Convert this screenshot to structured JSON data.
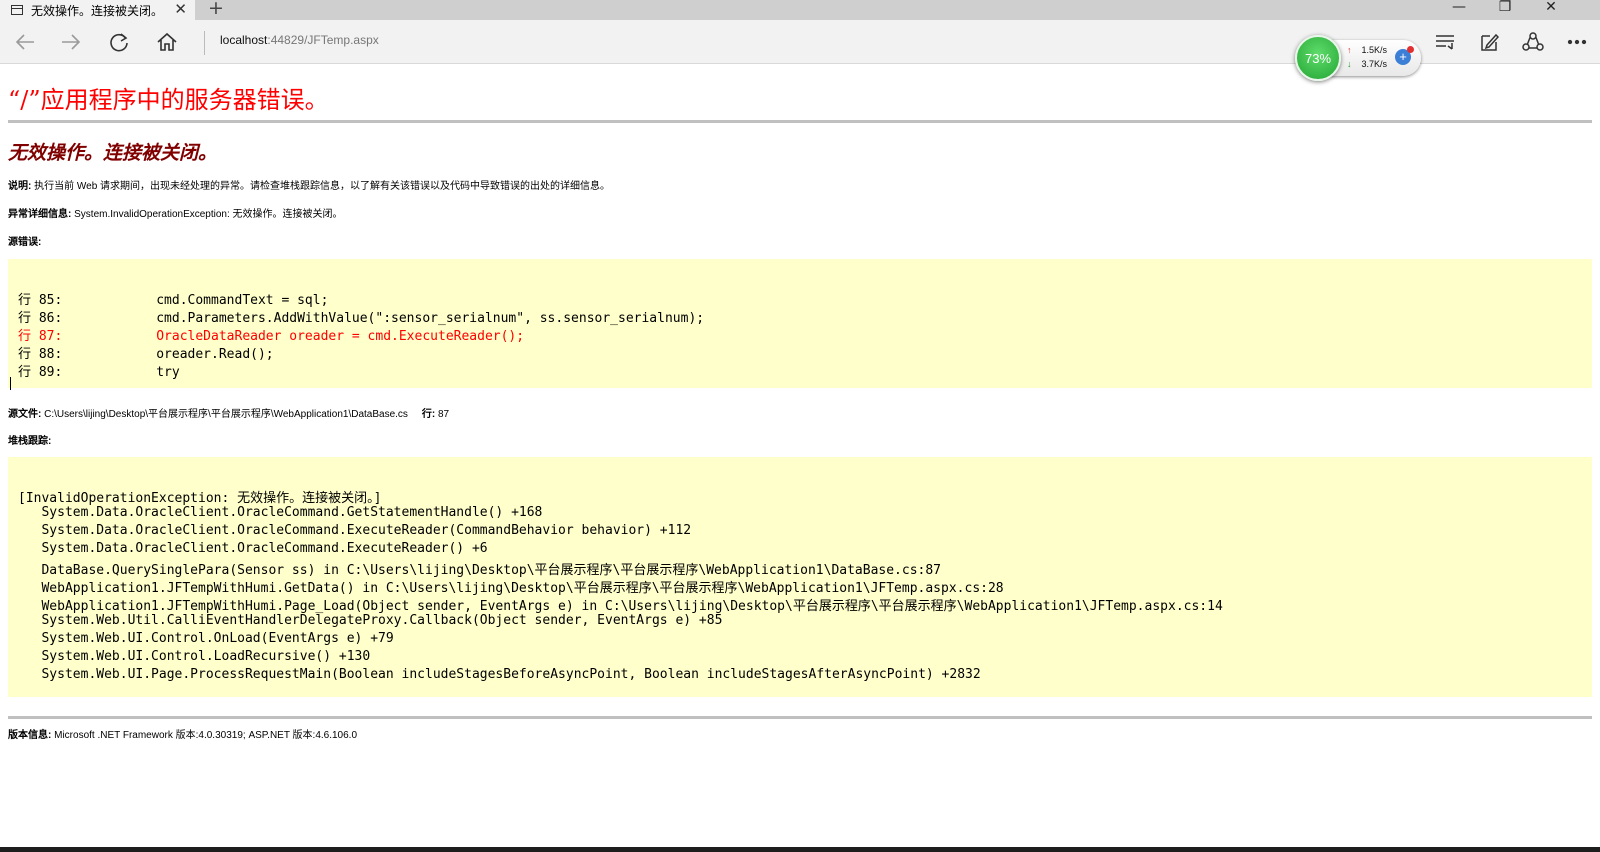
{
  "tab": {
    "title": "无效操作。连接被关闭。",
    "close": "✕",
    "new_tab": "+"
  },
  "window": {
    "minimize": "—",
    "restore": "❐",
    "close": "✕"
  },
  "address": {
    "host": "localhost",
    "path": ":44829/JFTemp.aspx"
  },
  "speed_widget": {
    "percent": "73%",
    "upload": "1.5K/s",
    "download": "3.7K/s",
    "up_arrow": "↑",
    "down_arrow": "↓",
    "plus": "+"
  },
  "error": {
    "title": "“/”应用程序中的服务器错误。",
    "subtitle": "无效操作。连接被关闭。",
    "description_label": "说明:",
    "description": " 执行当前 Web 请求期间，出现未经处理的异常。请检查堆栈跟踪信息，以了解有关该错误以及代码中导致错误的出处的详细信息。",
    "exception_label": "异常详细信息:",
    "exception": " System.InvalidOperationException: 无效操作。连接被关闭。",
    "source_error_label": "源错误:",
    "source_lines": [
      {
        "text": "行 85:            cmd.CommandText = sql;",
        "highlight": false
      },
      {
        "text": "行 86:            cmd.Parameters.AddWithValue(\":sensor_serialnum\", ss.sensor_serialnum);",
        "highlight": false
      },
      {
        "text": "行 87:            OracleDataReader oreader = cmd.ExecuteReader();",
        "highlight": true
      },
      {
        "text": "行 88:            oreader.Read();",
        "highlight": false
      },
      {
        "text": "行 89:            try",
        "highlight": false
      }
    ],
    "source_file_label": "源文件:",
    "source_file": " C:\\Users\\lijing\\Desktop\\平台展示程序\\平台展示程序\\WebApplication1\\DataBase.cs",
    "line_label": "行:",
    "line": " 87",
    "stack_label": "堆栈跟踪:",
    "stack_lines": [
      "[InvalidOperationException: 无效操作。连接被关闭。]",
      "   System.Data.OracleClient.OracleCommand.GetStatementHandle() +168",
      "   System.Data.OracleClient.OracleCommand.ExecuteReader(CommandBehavior behavior) +112",
      "   System.Data.OracleClient.OracleCommand.ExecuteReader() +6",
      "   DataBase.QuerySinglePara(Sensor ss) in C:\\Users\\lijing\\Desktop\\平台展示程序\\平台展示程序\\WebApplication1\\DataBase.cs:87",
      "   WebApplication1.JFTempWithHumi.GetData() in C:\\Users\\lijing\\Desktop\\平台展示程序\\平台展示程序\\WebApplication1\\JFTemp.aspx.cs:28",
      "   WebApplication1.JFTempWithHumi.Page_Load(Object sender, EventArgs e) in C:\\Users\\lijing\\Desktop\\平台展示程序\\平台展示程序\\WebApplication1\\JFTemp.aspx.cs:14",
      "   System.Web.Util.CalliEventHandlerDelegateProxy.Callback(Object sender, EventArgs e) +85",
      "   System.Web.UI.Control.OnLoad(EventArgs e) +79",
      "   System.Web.UI.Control.LoadRecursive() +130",
      "   System.Web.UI.Page.ProcessRequestMain(Boolean includeStagesBeforeAsyncPoint, Boolean includeStagesAfterAsyncPoint) +2832"
    ],
    "version_label": "版本信息:",
    "version": " Microsoft .NET Framework 版本:4.0.30319; ASP.NET 版本:4.6.106.0"
  },
  "colors": {
    "error_title": "#ff0000",
    "error_subtitle": "#800000",
    "code_background": "#ffffcc",
    "highlight_line": "#ff0000"
  },
  "icons": [
    "page-icon",
    "back-arrow-icon",
    "forward-arrow-icon",
    "refresh-icon",
    "home-icon",
    "hub-icon",
    "note-icon",
    "share-icon",
    "more-icon"
  ]
}
